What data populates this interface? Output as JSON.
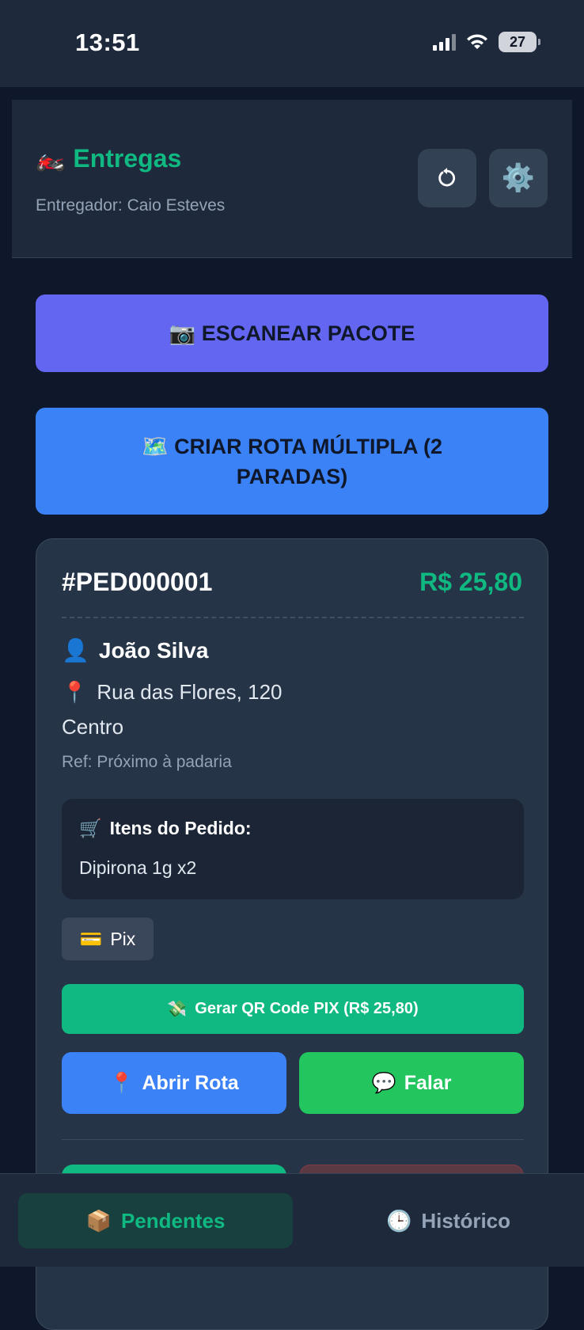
{
  "status_bar": {
    "time": "13:51",
    "battery": "27"
  },
  "header": {
    "icon": "motorcycle-emoji",
    "title": "Entregas",
    "courier": "Entregador: Caio Esteves",
    "refresh_icon": "refresh-icon",
    "settings_icon": "gear-icon"
  },
  "actions": {
    "scan_label": "ESCANEAR PACOTE",
    "scan_icon": "camera-emoji",
    "route_label": "CRIAR ROTA MÚLTIPLA (2 PARADAS)",
    "route_icon": "map-emoji"
  },
  "order": {
    "id": "#PED000001",
    "total": "R$ 25,80",
    "customer": "João Silva",
    "address": "Rua das Flores, 120",
    "district": "Centro",
    "reference": "Ref: Próximo à padaria",
    "items_title": "Itens do Pedido:",
    "items": "Dipirona 1g x2",
    "payment": "Pix",
    "pix_button": "Gerar QR Code PIX (R$ 25,80)",
    "open_route_button": "Abrir Rota",
    "talk_button": "Falar"
  },
  "nav": {
    "pending": "Pendentes",
    "history": "Histórico"
  },
  "colors": {
    "accent": "#10b981",
    "scan": "#6366f1",
    "route": "#3b82f6",
    "talk": "#22c55e",
    "background": "#0f172a"
  }
}
